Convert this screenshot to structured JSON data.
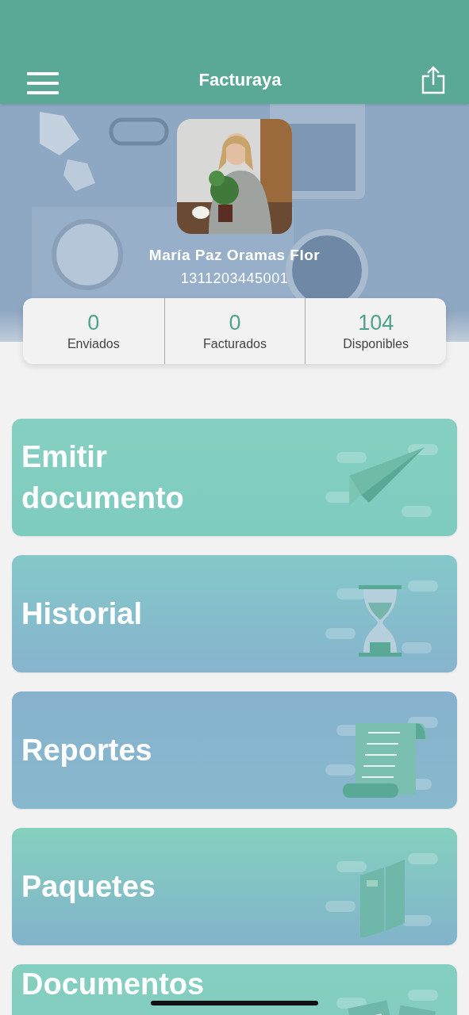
{
  "header": {
    "title": "Facturaya"
  },
  "profile": {
    "name": "María Paz Oramas Flor",
    "id_number": "1311203445001"
  },
  "stats": [
    {
      "value": "0",
      "label": "Enviados"
    },
    {
      "value": "0",
      "label": "Facturados"
    },
    {
      "value": "104",
      "label": "Disponibles"
    }
  ],
  "menu": [
    {
      "label": "Emitir documento",
      "kind": "plane"
    },
    {
      "label": "Historial",
      "kind": "hourglass"
    },
    {
      "label": "Reportes",
      "kind": "scroll"
    },
    {
      "label": "Paquetes",
      "kind": "binder"
    },
    {
      "label": "Documentos",
      "kind": "papers"
    }
  ]
}
